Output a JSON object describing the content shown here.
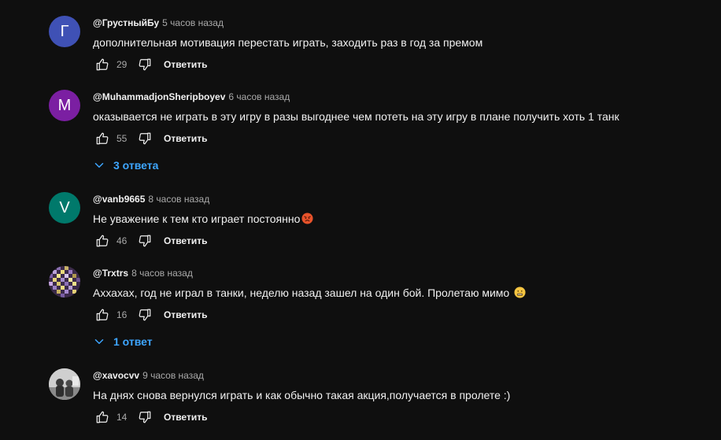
{
  "comments": [
    {
      "author": "@ГрустныйБу",
      "time": "5 часов назад",
      "text": "дополнительная мотивация перестать играть, заходить раз в год за премом",
      "likes": "29",
      "reply_label": "Ответить",
      "avatar": {
        "letter": "Г",
        "color": "#3f51b5"
      }
    },
    {
      "author": "@MuhammadjonSheripboyev",
      "time": "6 часов назад",
      "text": "оказывается не играть в эту игру в разы выгоднее чем потеть на эту игру в плане получить хоть 1 танк",
      "likes": "55",
      "reply_label": "Ответить",
      "avatar": {
        "letter": "M",
        "color": "#7b1fa2"
      },
      "replies_label": "3 ответа"
    },
    {
      "author": "@vanb9665",
      "time": "8 часов назад",
      "text": "Не уважение к тем кто играет постоянно",
      "emoji": "angry-face-emoji",
      "likes": "46",
      "reply_label": "Ответить",
      "avatar": {
        "letter": "V",
        "color": "#00796b"
      }
    },
    {
      "author": "@Trxtrs",
      "time": "8 часов назад",
      "text": "Аххахах, год не играл в танки, неделю назад зашел на один бой. Пролетаю мимо",
      "emoji": "grimacing-face-emoji",
      "likes": "16",
      "reply_label": "Ответить",
      "avatar": {
        "image": "pixel-mosaic"
      },
      "replies_label": "1 ответ"
    },
    {
      "author": "@xavocvv",
      "time": "9 часов назад",
      "text": "На днях снова вернулся играть и как обычно такая акция,получается в пролете :)",
      "likes": "14",
      "reply_label": "Ответить",
      "avatar": {
        "image": "photo-people"
      }
    }
  ],
  "colors": {
    "background": "#0f0f0f",
    "text": "#f1f1f1",
    "secondary_text": "#aaaaaa",
    "link": "#3ea6ff"
  }
}
